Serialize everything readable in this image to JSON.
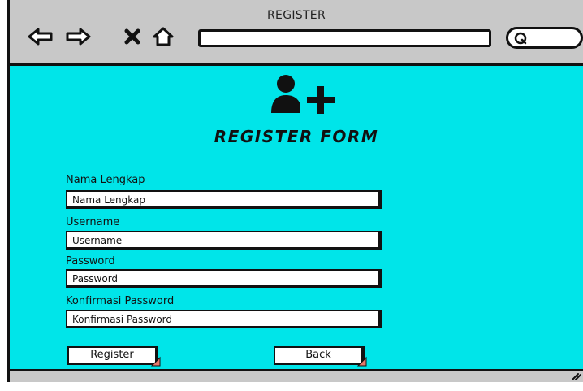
{
  "window": {
    "title": "REGISTER"
  },
  "toolbar": {
    "icons": [
      "back-arrow-icon",
      "forward-arrow-icon",
      "close-x-icon",
      "home-icon",
      "search-icon"
    ]
  },
  "form": {
    "icon": "user-add-icon",
    "title": "REGISTER FORM",
    "fields": [
      {
        "label": "Nama Lengkap",
        "value": "Nama Lengkap"
      },
      {
        "label": "Username",
        "value": "Username"
      },
      {
        "label": "Password",
        "value": "Password"
      },
      {
        "label": "Konfirmasi Password",
        "value": "Konfirmasi Password"
      }
    ],
    "register_label": "Register",
    "back_label": "Back"
  },
  "colors": {
    "content_background": "#00e5e9",
    "chrome_background": "#c8c8c8",
    "button_corner_accent": "#e5786a"
  }
}
